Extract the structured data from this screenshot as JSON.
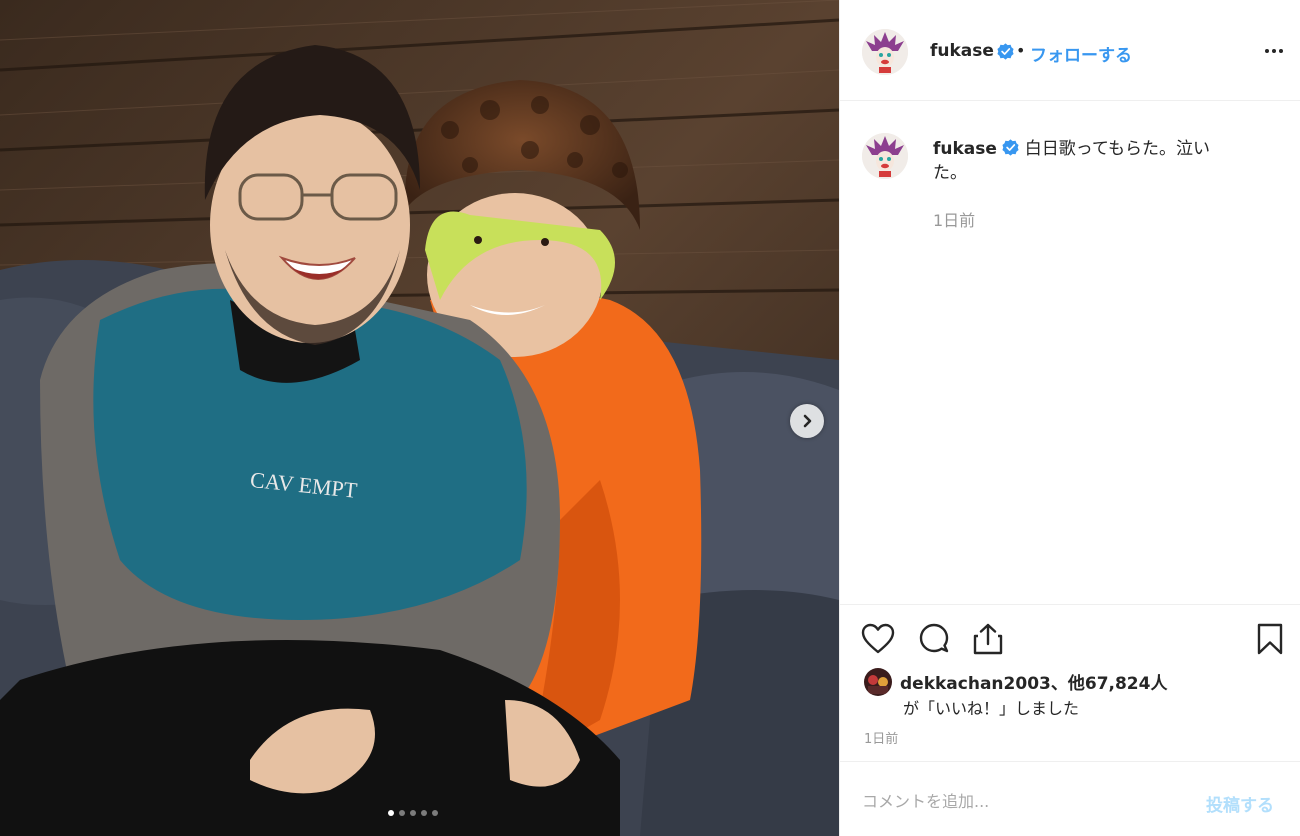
{
  "post": {
    "username": "fukase",
    "follow_label": "フォローする",
    "separator": "•",
    "caption": "白日歌ってもらた。泣いた。",
    "caption_time": "1日前",
    "sweater_print": "CAV EMPT",
    "carousel": {
      "total_slides": 5,
      "active_slide": 1
    }
  },
  "likes": {
    "first_liker": "dekkachan2003",
    "count_text": "、他67,824人",
    "suffix": "が「いいね！」しました"
  },
  "timestamp": "1日前",
  "comment": {
    "placeholder": "コメントを追加...",
    "submit_label": "投稿する"
  },
  "icons": [
    "verified-badge-icon",
    "more-options-icon",
    "heart-icon",
    "comment-icon",
    "share-icon",
    "bookmark-icon",
    "chevron-right-icon"
  ],
  "colors": {
    "link_blue": "#3897f0",
    "submit_disabled": "#b2dffc",
    "muted_text": "#999999",
    "text": "#262626",
    "border": "#efefef"
  }
}
